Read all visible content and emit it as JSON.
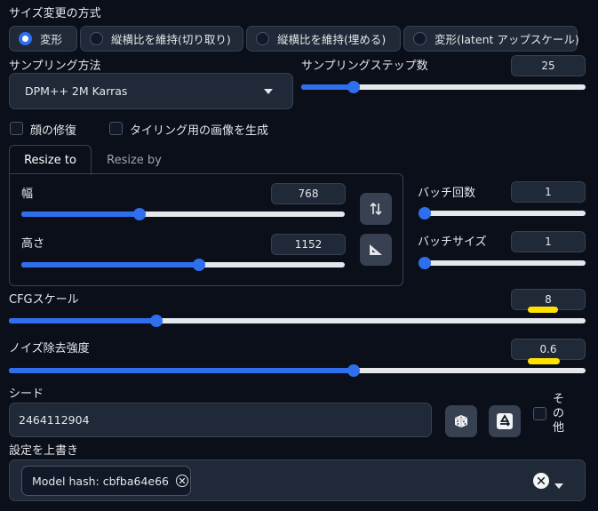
{
  "resize_mode": {
    "label": "サイズ変更の方式",
    "options": [
      "変形",
      "縦横比を維持(切り取り)",
      "縦横比を維持(埋める)",
      "変形(latent アップスケール)"
    ],
    "selected": "変形"
  },
  "sampling_method": {
    "label": "サンプリング方法",
    "value": "DPM++ 2M Karras"
  },
  "sampling_steps": {
    "label": "サンプリングステップ数",
    "value": "25"
  },
  "checkboxes": {
    "restore_faces": "顔の修復",
    "tiling": "タイリング用の画像を生成"
  },
  "resize_tabs": [
    "Resize to",
    "Resize by"
  ],
  "resize_active_tab": "Resize to",
  "width": {
    "label": "幅",
    "value": "768"
  },
  "height": {
    "label": "高さ",
    "value": "1152"
  },
  "batch_count": {
    "label": "バッチ回数",
    "value": "1"
  },
  "batch_size": {
    "label": "バッチサイズ",
    "value": "1"
  },
  "cfg_scale": {
    "label": "CFGスケール",
    "value": "8"
  },
  "denoising": {
    "label": "ノイズ除去強度",
    "value": "0.6"
  },
  "seed": {
    "label": "シード",
    "value": "2464112904",
    "extra_label": "その他"
  },
  "override": {
    "label": "設定を上書き",
    "tag": "Model hash: cbfba64e66"
  },
  "slider_levels": {
    "sampling_steps": 0.17,
    "width": 0.36,
    "height": 0.55,
    "batch_count": 0.0,
    "batch_size": 0.0,
    "cfg_scale": 0.25,
    "denoising": 0.6
  },
  "colors": {
    "accent": "#2f6fed",
    "highlight": "#ffe100",
    "background": "#0b0f19"
  }
}
